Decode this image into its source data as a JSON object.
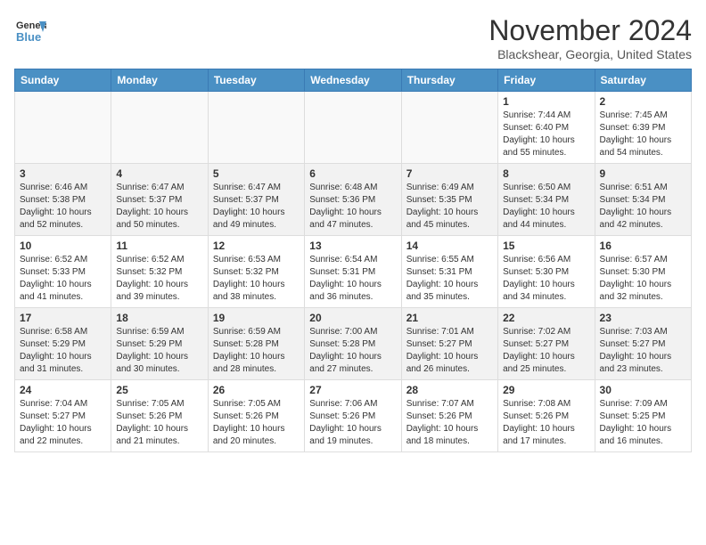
{
  "header": {
    "logo_line1": "General",
    "logo_line2": "Blue",
    "month": "November 2024",
    "location": "Blackshear, Georgia, United States"
  },
  "weekdays": [
    "Sunday",
    "Monday",
    "Tuesday",
    "Wednesday",
    "Thursday",
    "Friday",
    "Saturday"
  ],
  "weeks": [
    [
      {
        "day": "",
        "empty": true
      },
      {
        "day": "",
        "empty": true
      },
      {
        "day": "",
        "empty": true
      },
      {
        "day": "",
        "empty": true
      },
      {
        "day": "",
        "empty": true
      },
      {
        "day": "1",
        "rise": "7:44 AM",
        "set": "6:40 PM",
        "hours": "10 hours and 55 minutes."
      },
      {
        "day": "2",
        "rise": "7:45 AM",
        "set": "6:39 PM",
        "hours": "10 hours and 54 minutes."
      }
    ],
    [
      {
        "day": "3",
        "rise": "6:46 AM",
        "set": "5:38 PM",
        "hours": "10 hours and 52 minutes."
      },
      {
        "day": "4",
        "rise": "6:47 AM",
        "set": "5:37 PM",
        "hours": "10 hours and 50 minutes."
      },
      {
        "day": "5",
        "rise": "6:47 AM",
        "set": "5:37 PM",
        "hours": "10 hours and 49 minutes."
      },
      {
        "day": "6",
        "rise": "6:48 AM",
        "set": "5:36 PM",
        "hours": "10 hours and 47 minutes."
      },
      {
        "day": "7",
        "rise": "6:49 AM",
        "set": "5:35 PM",
        "hours": "10 hours and 45 minutes."
      },
      {
        "day": "8",
        "rise": "6:50 AM",
        "set": "5:34 PM",
        "hours": "10 hours and 44 minutes."
      },
      {
        "day": "9",
        "rise": "6:51 AM",
        "set": "5:34 PM",
        "hours": "10 hours and 42 minutes."
      }
    ],
    [
      {
        "day": "10",
        "rise": "6:52 AM",
        "set": "5:33 PM",
        "hours": "10 hours and 41 minutes."
      },
      {
        "day": "11",
        "rise": "6:52 AM",
        "set": "5:32 PM",
        "hours": "10 hours and 39 minutes."
      },
      {
        "day": "12",
        "rise": "6:53 AM",
        "set": "5:32 PM",
        "hours": "10 hours and 38 minutes."
      },
      {
        "day": "13",
        "rise": "6:54 AM",
        "set": "5:31 PM",
        "hours": "10 hours and 36 minutes."
      },
      {
        "day": "14",
        "rise": "6:55 AM",
        "set": "5:31 PM",
        "hours": "10 hours and 35 minutes."
      },
      {
        "day": "15",
        "rise": "6:56 AM",
        "set": "5:30 PM",
        "hours": "10 hours and 34 minutes."
      },
      {
        "day": "16",
        "rise": "6:57 AM",
        "set": "5:30 PM",
        "hours": "10 hours and 32 minutes."
      }
    ],
    [
      {
        "day": "17",
        "rise": "6:58 AM",
        "set": "5:29 PM",
        "hours": "10 hours and 31 minutes."
      },
      {
        "day": "18",
        "rise": "6:59 AM",
        "set": "5:29 PM",
        "hours": "10 hours and 30 minutes."
      },
      {
        "day": "19",
        "rise": "6:59 AM",
        "set": "5:28 PM",
        "hours": "10 hours and 28 minutes."
      },
      {
        "day": "20",
        "rise": "7:00 AM",
        "set": "5:28 PM",
        "hours": "10 hours and 27 minutes."
      },
      {
        "day": "21",
        "rise": "7:01 AM",
        "set": "5:27 PM",
        "hours": "10 hours and 26 minutes."
      },
      {
        "day": "22",
        "rise": "7:02 AM",
        "set": "5:27 PM",
        "hours": "10 hours and 25 minutes."
      },
      {
        "day": "23",
        "rise": "7:03 AM",
        "set": "5:27 PM",
        "hours": "10 hours and 23 minutes."
      }
    ],
    [
      {
        "day": "24",
        "rise": "7:04 AM",
        "set": "5:27 PM",
        "hours": "10 hours and 22 minutes."
      },
      {
        "day": "25",
        "rise": "7:05 AM",
        "set": "5:26 PM",
        "hours": "10 hours and 21 minutes."
      },
      {
        "day": "26",
        "rise": "7:05 AM",
        "set": "5:26 PM",
        "hours": "10 hours and 20 minutes."
      },
      {
        "day": "27",
        "rise": "7:06 AM",
        "set": "5:26 PM",
        "hours": "10 hours and 19 minutes."
      },
      {
        "day": "28",
        "rise": "7:07 AM",
        "set": "5:26 PM",
        "hours": "10 hours and 18 minutes."
      },
      {
        "day": "29",
        "rise": "7:08 AM",
        "set": "5:26 PM",
        "hours": "10 hours and 17 minutes."
      },
      {
        "day": "30",
        "rise": "7:09 AM",
        "set": "5:25 PM",
        "hours": "10 hours and 16 minutes."
      }
    ]
  ]
}
